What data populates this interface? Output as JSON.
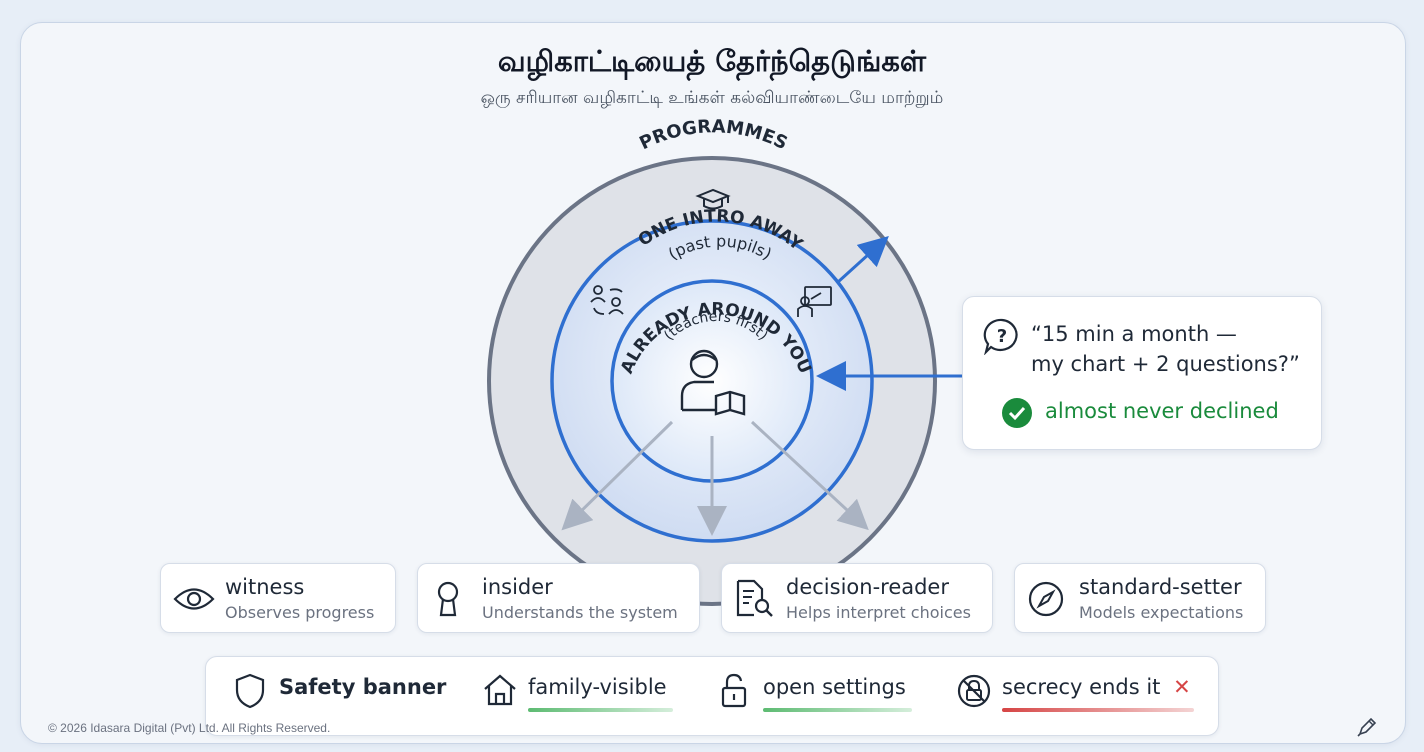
{
  "header": {
    "title": "வழிகாட்டியைத் தேர்ந்தெடுங்கள்",
    "subtitle": "ஒரு சரியான வழிகாட்டி உங்கள் கல்வியாண்டையே மாற்றும்"
  },
  "rings": {
    "outer": {
      "label": "PROGRAMMES",
      "icon": "graduation-cap-icon"
    },
    "middle": {
      "label": "ONE INTRO AWAY",
      "sublabel": "(past pupils)"
    },
    "inner": {
      "label": "ALREADY AROUND YOU",
      "sublabel": "(teachers first)",
      "icon": "person-reading-icon"
    },
    "side_icons": [
      "people-exchange-icon",
      "teacher-board-icon"
    ]
  },
  "quote": {
    "line1": "“15 min a month —",
    "line2": "my chart + 2 questions?”",
    "footnote": "almost never declined",
    "icon": "question-bubble-icon"
  },
  "roles": [
    {
      "title": "witness",
      "subtitle": "Observes progress",
      "icon": "eye-icon"
    },
    {
      "title": "insider",
      "subtitle": "Understands the system",
      "icon": "keyhole-icon"
    },
    {
      "title": "decision-reader",
      "subtitle": "Helps interpret choices",
      "icon": "document-search-icon"
    },
    {
      "title": "standard-setter",
      "subtitle": "Models expectations",
      "icon": "compass-icon"
    }
  ],
  "banner": {
    "title": "Safety banner",
    "items": [
      {
        "label": "family-visible",
        "icon": "house-icon",
        "status": "positive"
      },
      {
        "label": "open settings",
        "icon": "open-lock-icon",
        "status": "positive"
      },
      {
        "label": "secrecy ends it",
        "icon": "no-secrecy-icon",
        "status": "negative",
        "mark": "✕"
      }
    ]
  },
  "colors": {
    "accent_blue": "#2f6fd0",
    "positive_green": "#1a8b3c",
    "negative_red": "#d64545",
    "outer_ring": "#6b7486"
  },
  "footer": {
    "copyright": "© 2026 Idasara Digital (Pvt) Ltd. All Rights Reserved."
  }
}
